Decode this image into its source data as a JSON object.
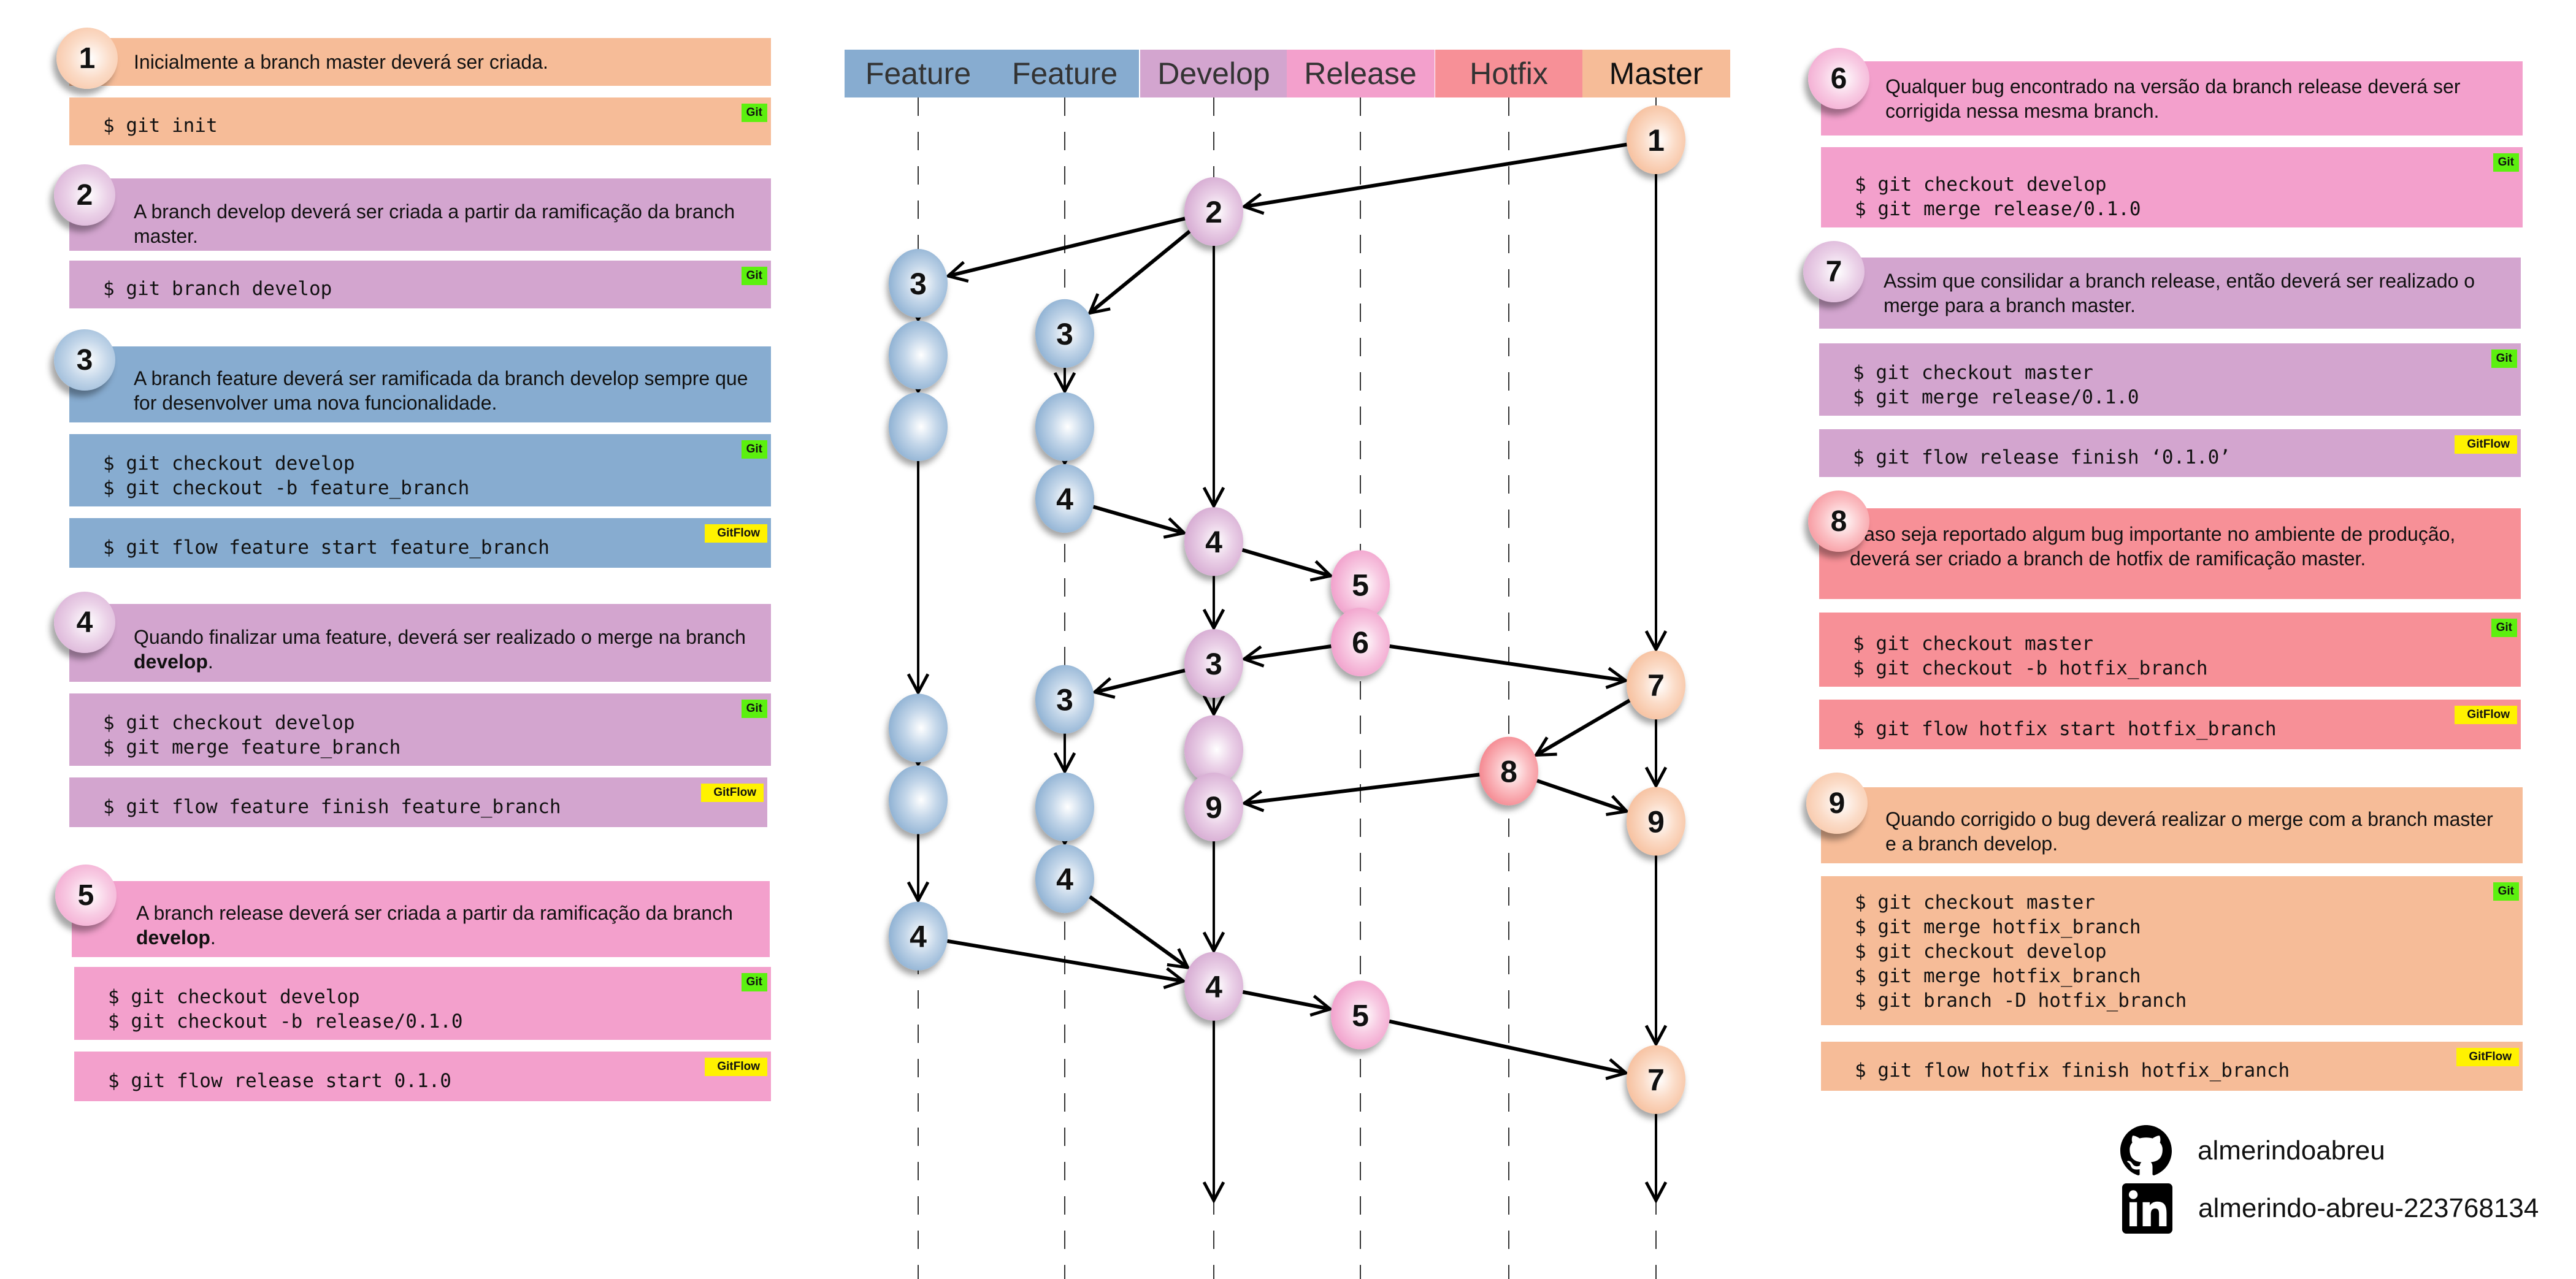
{
  "colors": {
    "master": "#f6bc98",
    "develop": "#d3a5cf",
    "feature": "#87acd0",
    "release": "#f3a0cc",
    "hotfix": "#f79097",
    "git_badge": "#5cf00f",
    "gitflow_badge": "#fff200"
  },
  "badges": {
    "git": "Git",
    "gitflow": "GitFlow"
  },
  "left_steps": [
    {
      "number": "1",
      "description": "Inicialmente a branch master deverá ser criada.",
      "git_commands": [
        "$ git init"
      ]
    },
    {
      "number": "2",
      "description": "A branch develop deverá ser criada a partir da ramificação da branch master.",
      "git_commands": [
        "$ git branch develop"
      ]
    },
    {
      "number": "3",
      "description": "A branch feature deverá ser ramificada da branch develop sempre que for desenvolver uma nova funcionalidade.",
      "git_commands": [
        "$ git checkout develop",
        "$ git checkout -b feature_branch"
      ],
      "gitflow_command": "$ git flow feature start feature_branch"
    },
    {
      "number": "4",
      "description_pre": "Quando finalizar uma feature, deverá ser realizado o merge na branch ",
      "description_bold": "develop",
      "description_post": ".",
      "git_commands": [
        "$ git checkout develop",
        "$ git merge feature_branch"
      ],
      "gitflow_command": "$ git flow feature finish feature_branch"
    },
    {
      "number": "5",
      "description_pre": "A branch release deverá ser criada a partir da ramificação da branch ",
      "description_bold": "develop",
      "description_post": ".",
      "git_commands": [
        "$ git checkout develop",
        "$ git checkout -b release/0.1.0"
      ],
      "gitflow_command": "$ git flow release start 0.1.0"
    }
  ],
  "right_steps": [
    {
      "number": "6",
      "description": "Qualquer bug encontrado na versão da branch release deverá ser corrigida nessa mesma branch.",
      "git_commands": [
        "$ git checkout develop",
        "$ git merge release/0.1.0"
      ]
    },
    {
      "number": "7",
      "description": "Assim que consilidar a branch release, então deverá ser realizado o merge para a branch master.",
      "git_commands": [
        "$ git checkout master",
        "$ git merge release/0.1.0"
      ],
      "gitflow_command": "$ git flow release finish ‘0.1.0’"
    },
    {
      "number": "8",
      "description": "Caso seja reportado algum bug importante no ambiente de produção, deverá ser criado a branch de hotfix de ramificação master.",
      "git_commands": [
        "$ git checkout master",
        "$ git checkout -b hotfix_branch"
      ],
      "gitflow_command": "$ git flow hotfix start hotfix_branch"
    },
    {
      "number": "9",
      "description": "Quando corrigido o bug deverá realizar o merge com a branch master e a branch develop.",
      "git_commands": [
        "$ git checkout master",
        "$ git merge hotfix_branch",
        "$ git checkout develop",
        "$ git merge hotfix_branch",
        "$ git branch -D hotfix_branch"
      ],
      "gitflow_command": "$ git flow hotfix finish hotfix_branch"
    }
  ],
  "diagram": {
    "lanes": [
      {
        "label": "Feature",
        "branch": "feature"
      },
      {
        "label": "Feature",
        "branch": "feature"
      },
      {
        "label": "Develop",
        "branch": "develop"
      },
      {
        "label": "Release",
        "branch": "release"
      },
      {
        "label": "Hotfix",
        "branch": "hotfix"
      },
      {
        "label": "Master",
        "branch": "master"
      }
    ],
    "nodes": [
      {
        "id": "m1",
        "lane": 5,
        "row": 0,
        "label": "1"
      },
      {
        "id": "d2",
        "lane": 2,
        "row": 1,
        "label": "2"
      },
      {
        "id": "fa3",
        "lane": 0,
        "row": 2,
        "label": "3"
      },
      {
        "id": "fa_a",
        "lane": 0,
        "row": 3,
        "label": ""
      },
      {
        "id": "fa_b",
        "lane": 0,
        "row": 4,
        "label": ""
      },
      {
        "id": "fb3",
        "lane": 1,
        "row": 2.7,
        "label": "3"
      },
      {
        "id": "fb_a",
        "lane": 1,
        "row": 4,
        "label": ""
      },
      {
        "id": "fb4",
        "lane": 1,
        "row": 5,
        "label": "4"
      },
      {
        "id": "d4",
        "lane": 2,
        "row": 5.6,
        "label": "4"
      },
      {
        "id": "r5",
        "lane": 3,
        "row": 6.2,
        "label": "5"
      },
      {
        "id": "r6",
        "lane": 3,
        "row": 7,
        "label": "6"
      },
      {
        "id": "d3",
        "lane": 2,
        "row": 7.3,
        "label": "3"
      },
      {
        "id": "m7",
        "lane": 5,
        "row": 7.6,
        "label": "7"
      },
      {
        "id": "fb3b",
        "lane": 1,
        "row": 7.8,
        "label": "3"
      },
      {
        "id": "fa_c",
        "lane": 0,
        "row": 8.2,
        "label": ""
      },
      {
        "id": "d_c",
        "lane": 2,
        "row": 8.5,
        "label": ""
      },
      {
        "id": "h8",
        "lane": 4,
        "row": 8.8,
        "label": "8"
      },
      {
        "id": "fa_d",
        "lane": 0,
        "row": 9.2,
        "label": ""
      },
      {
        "id": "fb_b",
        "lane": 1,
        "row": 9.3,
        "label": ""
      },
      {
        "id": "d9",
        "lane": 2,
        "row": 9.3,
        "label": "9"
      },
      {
        "id": "m9",
        "lane": 5,
        "row": 9.5,
        "label": "9"
      },
      {
        "id": "fb4b",
        "lane": 1,
        "row": 10.3,
        "label": "4"
      },
      {
        "id": "fa4",
        "lane": 0,
        "row": 11.1,
        "label": "4"
      },
      {
        "id": "d4b",
        "lane": 2,
        "row": 11.8,
        "label": "4"
      },
      {
        "id": "r5b",
        "lane": 3,
        "row": 12.2,
        "label": "5"
      },
      {
        "id": "m7b",
        "lane": 5,
        "row": 13.1,
        "label": "7"
      }
    ],
    "edges": [
      [
        "m1",
        "d2"
      ],
      [
        "d2",
        "fa3"
      ],
      [
        "d2",
        "fb3"
      ],
      [
        "fa3",
        "fa_a"
      ],
      [
        "fa_a",
        "fa_b"
      ],
      [
        "fb3",
        "fb_a"
      ],
      [
        "fb_a",
        "fb4"
      ],
      [
        "d2",
        "d4"
      ],
      [
        "fb4",
        "d4"
      ],
      [
        "d4",
        "r5"
      ],
      [
        "r5",
        "r6"
      ],
      [
        "d4",
        "d3"
      ],
      [
        "r6",
        "d3"
      ],
      [
        "r6",
        "m7"
      ],
      [
        "m1",
        "m7"
      ],
      [
        "d3",
        "fb3b"
      ],
      [
        "fa_b",
        "fa_c"
      ],
      [
        "d3",
        "d_c"
      ],
      [
        "m7",
        "h8"
      ],
      [
        "fa_c",
        "fa_d"
      ],
      [
        "fb3b",
        "fb_b"
      ],
      [
        "d_c",
        "d9"
      ],
      [
        "h8",
        "d9"
      ],
      [
        "h8",
        "m9"
      ],
      [
        "m7",
        "m9"
      ],
      [
        "fb_b",
        "fb4b"
      ],
      [
        "fa_d",
        "fa4"
      ],
      [
        "fa4",
        "d4b"
      ],
      [
        "fb4b",
        "d4b"
      ],
      [
        "d9",
        "d4b"
      ],
      [
        "d4b",
        "r5b"
      ],
      [
        "r5b",
        "m7b"
      ],
      [
        "m9",
        "m7b"
      ],
      [
        "d4b",
        "END_d"
      ],
      [
        "m7b",
        "END_m"
      ]
    ]
  },
  "social": {
    "github": "almerindoabreu",
    "linkedin": "almerindo-abreu-223768134"
  }
}
